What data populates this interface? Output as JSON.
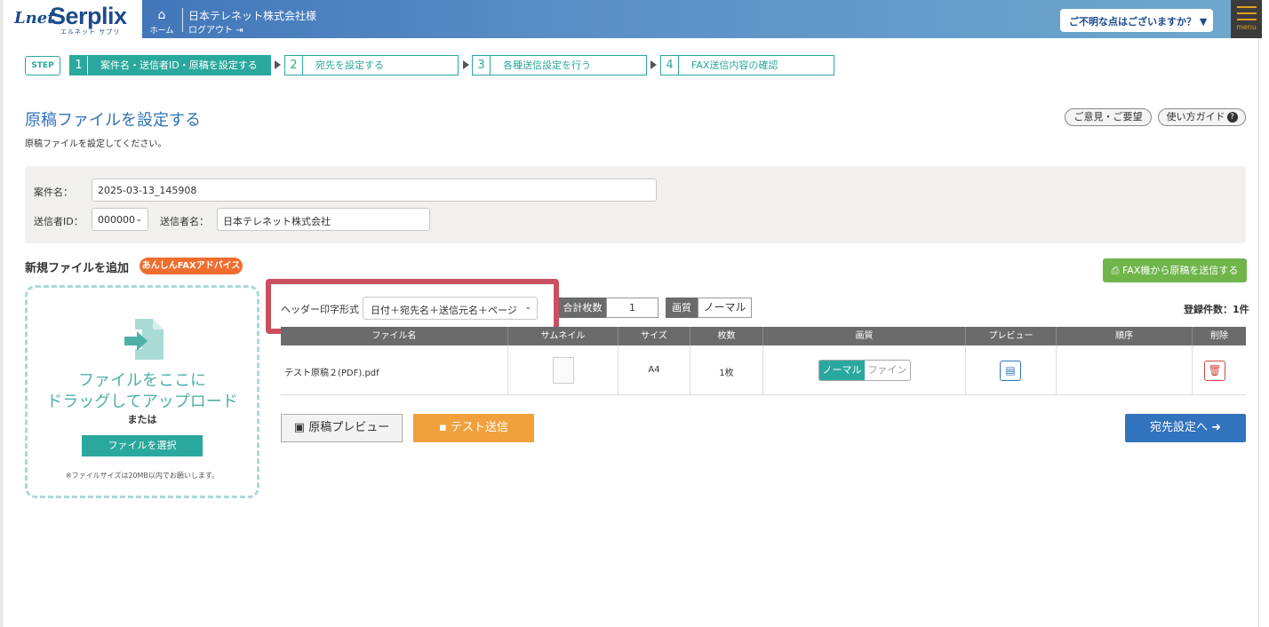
{
  "header": {
    "logo_lnet": "Lnet",
    "logo_name": "Serplix",
    "logo_sub": "エルネット サプリ",
    "home_label": "ホーム",
    "company": "日本テレネット株式会社様",
    "logout_label": "ログアウト",
    "help_select": "ご不明な点はございますか？ ▼",
    "menu_label": "menu"
  },
  "steps": {
    "tag": "STEP",
    "items": [
      {
        "num": "1",
        "label": "案件名・送信者ID・原稿を設定する"
      },
      {
        "num": "2",
        "label": "宛先を設定する"
      },
      {
        "num": "3",
        "label": "各種送信設定を行う"
      },
      {
        "num": "4",
        "label": "FAX送信内容の確認"
      }
    ]
  },
  "page": {
    "title": "原稿ファイルを設定する",
    "subtitle": "原稿ファイルを設定してください。",
    "feedback_button": "ご意見・ご要望",
    "guide_button": "使い方ガイド"
  },
  "form": {
    "case_label": "案件名：",
    "case_value": "2025-03-13_145908",
    "sender_id_label": "送信者ID：",
    "sender_id_value": "000000",
    "sender_name_label": "送信者名：",
    "sender_name_value": "日本テレネット株式会社"
  },
  "newfile": {
    "heading": "新規ファイルを追加",
    "advice_badge": "あんしんFAXアドバイス",
    "fax_send_button": "FAX機から原稿を送信する",
    "drop_line1": "ファイルをここに",
    "drop_line2": "ドラッグしてアップロード",
    "drop_or": "または",
    "choose_button": "ファイルを選択",
    "drop_note": "※ファイルサイズは20MB以内でお願いします。"
  },
  "options": {
    "header_print_label": "ヘッダー印字形式",
    "header_print_value": "日付＋宛先名＋送信元名＋ページ",
    "total_label": "合計枚数",
    "total_value": "1",
    "quality_label": "画質",
    "quality_value": "ノーマル",
    "registered_count": "登録件数：1件"
  },
  "table": {
    "columns": [
      "ファイル名",
      "サムネイル",
      "サイズ",
      "枚数",
      "画質",
      "プレビュー",
      "順序",
      "削除"
    ],
    "rows": [
      {
        "filename": "テスト原稿２(PDF).pdf",
        "size": "A4",
        "pages": "1枚",
        "quality_on": "ノーマル",
        "quality_off": "ファイン"
      }
    ]
  },
  "actions": {
    "preview_button": "原稿プレビュー",
    "test_button": "テスト送信",
    "next_button": "宛先設定へ"
  },
  "colors": {
    "accent": "#2aa89d",
    "primary": "#3173bd",
    "highlight": "#c9505f",
    "warning": "#f0a13c"
  }
}
